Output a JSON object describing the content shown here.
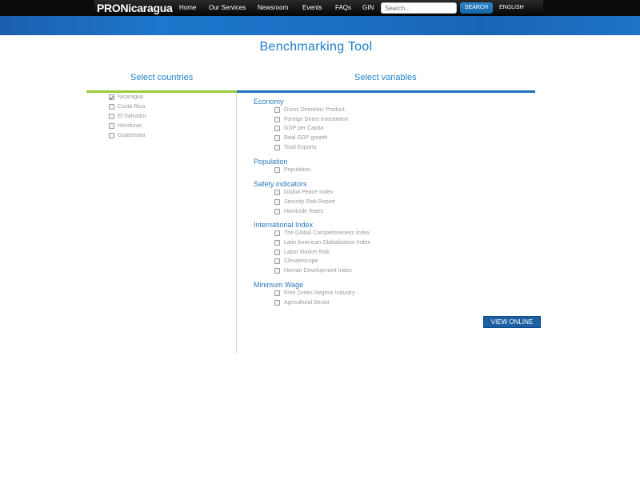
{
  "header": {
    "logo": "PRONicaragua",
    "nav": [
      "Home",
      "Our Services",
      "Newsroom",
      "Events",
      "FAQs",
      "GIN"
    ],
    "search_placeholder": "Search...",
    "search_button": "SEARCH",
    "language": "ENGLISH"
  },
  "page": {
    "title": "Benchmarking Tool"
  },
  "countries": {
    "heading": "Select countries",
    "items": [
      {
        "label": "Nicaragua",
        "checked": true
      },
      {
        "label": "Costa Rica",
        "checked": false
      },
      {
        "label": "El Salvador",
        "checked": false
      },
      {
        "label": "Honduras",
        "checked": false
      },
      {
        "label": "Guatemala",
        "checked": false
      }
    ]
  },
  "variables": {
    "heading": "Select variables",
    "groups": [
      {
        "name": "Economy",
        "items": [
          "Gross Domestic Product",
          "Foreign Direct Investment",
          "GDP per Capita",
          "Real GDP growth",
          "Total Exports"
        ]
      },
      {
        "name": "Population",
        "items": [
          "Population"
        ]
      },
      {
        "name": "Safety indicators",
        "items": [
          "Global Peace Index",
          "Security Risk Report",
          "Homicide Rates"
        ]
      },
      {
        "name": "International Index",
        "items": [
          "The Global Competitiveness Index",
          "Latin American Globalization Index",
          "Labor Market Risk",
          "Climatescope",
          "Human Development Index"
        ]
      },
      {
        "name": "Minimum Wage",
        "items": [
          "Free Zones Regime Industry",
          "Agricultural Sector"
        ]
      }
    ],
    "view_button": "VIEW ONLINE"
  },
  "colors": {
    "accent_blue": "#1a7cc6",
    "accent_green": "#9ccc3a",
    "nav_bg": "#0b0b0b"
  }
}
